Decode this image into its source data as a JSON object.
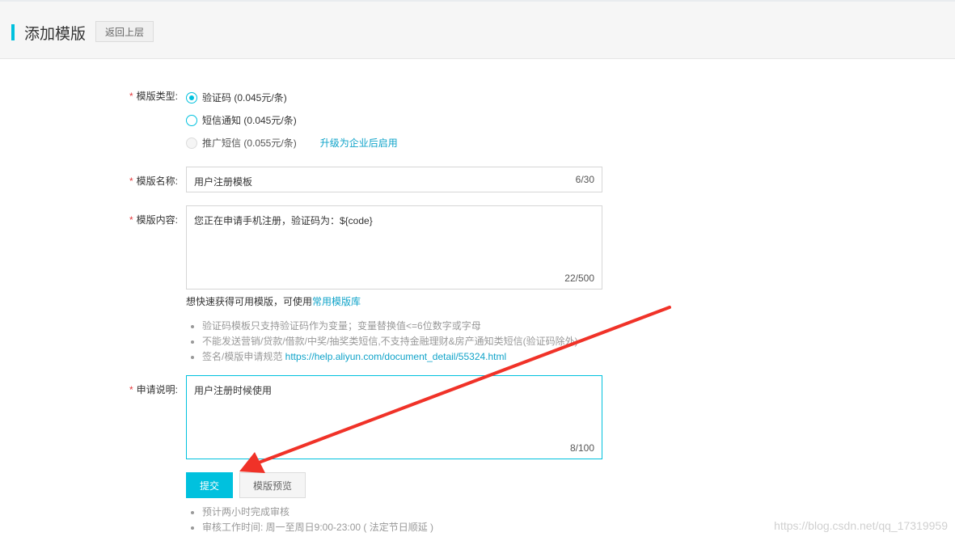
{
  "header": {
    "title": "添加模版",
    "back_label": "返回上层",
    "accent_color": "#00c1de"
  },
  "form": {
    "template_type": {
      "label": "模版类型:",
      "options": [
        {
          "label": "验证码 (0.045元/条)",
          "selected": true,
          "disabled": false
        },
        {
          "label": "短信通知 (0.045元/条)",
          "selected": false,
          "disabled": false
        },
        {
          "label": "推广短信 (0.055元/条)",
          "selected": false,
          "disabled": true
        }
      ],
      "upgrade_link": "升级为企业后启用"
    },
    "template_name": {
      "label": "模版名称:",
      "value": "用户注册模板",
      "count": "6/30"
    },
    "template_content": {
      "label": "模版内容:",
      "value": "您正在申请手机注册，验证码为：${code}",
      "count": "22/500",
      "hint_prefix": "想快速获得可用模版，可使用",
      "hint_link": "常用模版库"
    },
    "tips": [
      {
        "text": "验证码模板只支持验证码作为变量；变量替换值<=6位数字或字母",
        "link": ""
      },
      {
        "text": "不能发送营销/贷款/借款/中奖/抽奖类短信,不支持金融理财&房产通知类短信(验证码除外)",
        "link": ""
      },
      {
        "text": "签名/模版申请规范 ",
        "link": "https://help.aliyun.com/document_detail/55324.html"
      }
    ],
    "apply_note": {
      "label": "申请说明:",
      "value": "用户注册时候使用",
      "count": "8/100"
    },
    "submit_label": "提交",
    "preview_label": "模版预览",
    "footer_tips": [
      "预计两小时完成审核",
      "审核工作时间: 周一至周日9:00-23:00 ( 法定节日顺延 )"
    ]
  },
  "watermark": "https://blog.csdn.net/qq_17319959"
}
